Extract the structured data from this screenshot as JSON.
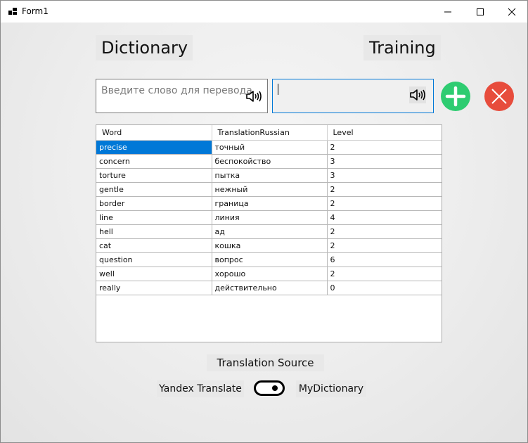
{
  "window": {
    "title": "Form1"
  },
  "headings": {
    "dictionary": "Dictionary",
    "training": "Training"
  },
  "inputs": {
    "word_placeholder": "Введите слово для перевода",
    "word_value": "",
    "translation_value": ""
  },
  "icons": {
    "add": "plus-icon",
    "delete": "close-icon",
    "speaker": "speaker-icon",
    "add_color": "#2ecc71",
    "delete_color": "#e74c3c",
    "selection_color": "#0078d7"
  },
  "table": {
    "columns": [
      "Word",
      "TranslationRussian",
      "Level"
    ],
    "rows": [
      [
        "precise",
        "точный",
        "2"
      ],
      [
        "concern",
        "беспокойство",
        "3"
      ],
      [
        "torture",
        "пытка",
        "3"
      ],
      [
        "gentle",
        "нежный",
        "2"
      ],
      [
        "border",
        "граница",
        "2"
      ],
      [
        "line",
        "линия",
        "4"
      ],
      [
        "hell",
        "ад",
        "2"
      ],
      [
        "cat",
        "кошка",
        "2"
      ],
      [
        "question",
        "вопрос",
        "6"
      ],
      [
        "well",
        "хорошо",
        "2"
      ],
      [
        "really",
        "действительно",
        "0"
      ]
    ]
  },
  "source": {
    "label": "Translation Source",
    "left_option": "Yandex Translate",
    "right_option": "MyDictionary",
    "toggle_state": "on"
  }
}
